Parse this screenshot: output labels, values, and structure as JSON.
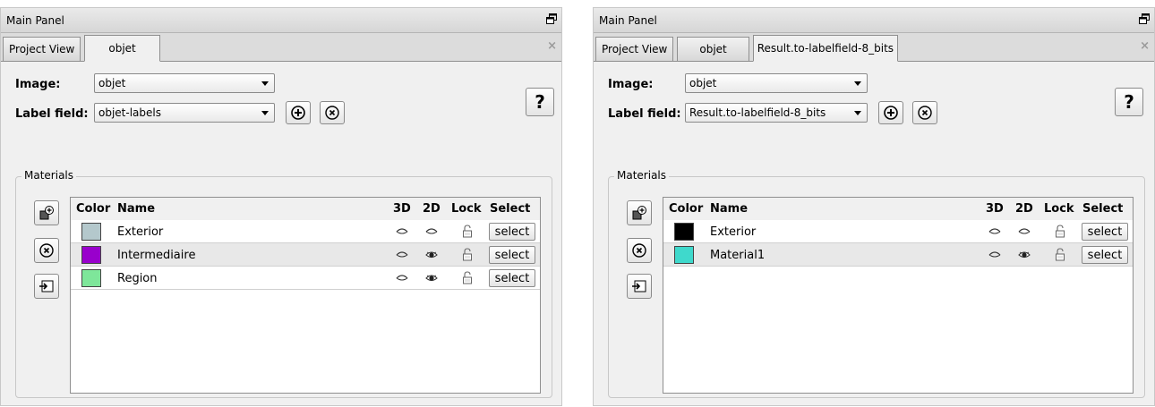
{
  "panels": [
    {
      "title": "Main Panel",
      "tabs": [
        "Project View",
        "objet"
      ],
      "image_label": "Image:",
      "image_value": "objet",
      "labelfield_label": "Label field:",
      "labelfield_value": "objet-labels",
      "help": "?",
      "materials_title": "Materials",
      "headers": {
        "color": "Color",
        "name": "Name",
        "d3": "3D",
        "d2": "2D",
        "lock": "Lock",
        "select": "Select"
      },
      "rows": [
        {
          "color": "#b4c8cc",
          "name": "Exterior",
          "d2": "closed",
          "select": "select"
        },
        {
          "color": "#9900cc",
          "name": "Intermediaire",
          "d2": "open",
          "select": "select"
        },
        {
          "color": "#7ee69a",
          "name": "Region",
          "d2": "open",
          "select": "select"
        }
      ]
    },
    {
      "title": "Main Panel",
      "tabs": [
        "Project View",
        "objet",
        "Result.to-labelfield-8_bits"
      ],
      "image_label": "Image:",
      "image_value": "objet",
      "labelfield_label": "Label field:",
      "labelfield_value": "Result.to-labelfield-8_bits",
      "help": "?",
      "materials_title": "Materials",
      "headers": {
        "color": "Color",
        "name": "Name",
        "d3": "3D",
        "d2": "2D",
        "lock": "Lock",
        "select": "Select"
      },
      "rows": [
        {
          "color": "#000000",
          "name": "Exterior",
          "d2": "closed",
          "select": "select"
        },
        {
          "color": "#3fd9cc",
          "name": "Material1",
          "d2": "open",
          "select": "select"
        }
      ]
    }
  ],
  "icons": {
    "float": "float-window-icon",
    "close_tab": "close-tab-icon",
    "add_labelfield": "plus-circle-icon",
    "remove_labelfield": "x-circle-icon",
    "add_material": "add-material-icon",
    "remove_material": "x-circle-icon",
    "import_material": "import-icon",
    "visibility": "eye-icon",
    "lock": "padlock-icon"
  }
}
